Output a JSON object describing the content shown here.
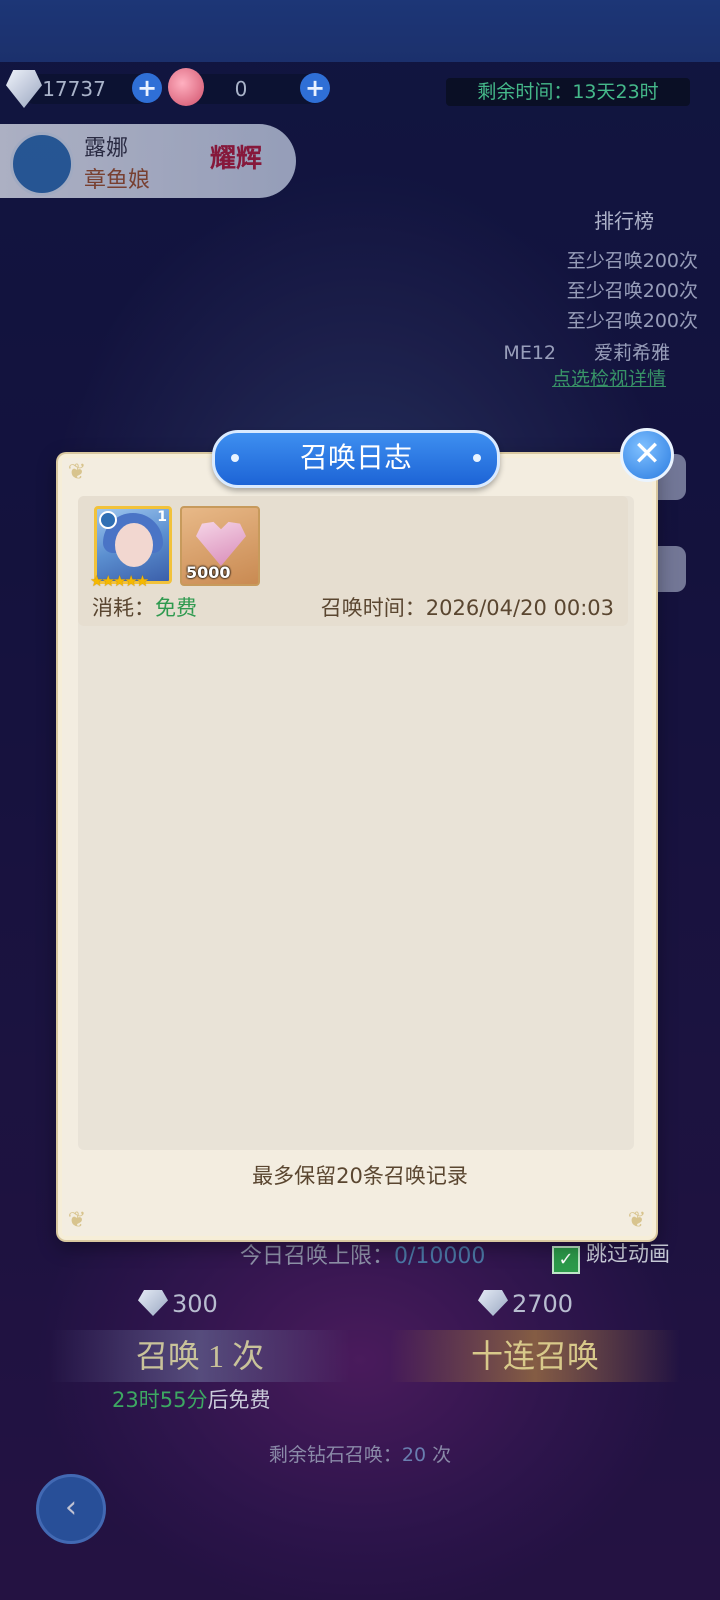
{
  "currencies": [
    {
      "value": "17737",
      "plus": "+"
    },
    {
      "value": "0",
      "plus": "+"
    }
  ],
  "timer": "剩余时间：13天23时",
  "hero": {
    "name": "露娜",
    "race": "章鱼娘",
    "tag": "耀辉"
  },
  "ranking": {
    "title": "排行榜",
    "rows": [
      "至少召唤200次",
      "至少召唤200次",
      "至少召唤200次"
    ],
    "me": "ME12　　爱莉希雅",
    "link": "点选检视详情"
  },
  "dialog": {
    "title": "召唤日志",
    "close": "✕",
    "entries": [
      {
        "hero_level": "1",
        "hero_stars": "★★★★★",
        "item_qty": "5000",
        "cost_label": "消耗：",
        "cost_value": "免费",
        "time_label": "召唤时间：",
        "time_value": "2026/04/20 00:03"
      }
    ],
    "footer": "最多保留20条召唤记录"
  },
  "bottom": {
    "limit_label": "今日召唤上限：",
    "limit_value": "0/10000",
    "skip_label": "跳过动画",
    "cost_one": "300",
    "cost_ten": "2700",
    "summon_one": "召唤 1 次",
    "summon_ten": "十连召唤",
    "free_time": "23时55分",
    "free_suffix": "后免费",
    "remain_label": "剩余钻石召唤：",
    "remain_value": "20",
    "remain_unit": " 次"
  },
  "colors": {
    "accent": "#1d64d6",
    "free": "#2f9a4f",
    "timer": "#45b98a"
  },
  "icons": [
    "gem-icon",
    "potion-icon",
    "water-element-icon",
    "close-icon",
    "checkbox-icon",
    "back-icon"
  ]
}
